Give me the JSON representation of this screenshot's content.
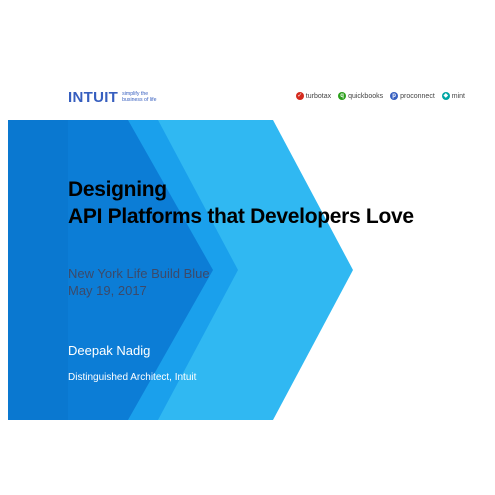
{
  "header": {
    "logo_text": "INTUIT",
    "tagline": "simplify the business of life",
    "brands": [
      {
        "label": "turbotax",
        "color": "#d52b1e",
        "icon": "turbotax-check-icon"
      },
      {
        "label": "quickbooks",
        "color": "#2ca01c",
        "icon": "quickbooks-qb-icon"
      },
      {
        "label": "proconnect",
        "color": "#365ebf",
        "icon": "proconnect-p-icon"
      },
      {
        "label": "mint",
        "color": "#00a6a4",
        "icon": "mint-leaf-icon"
      }
    ]
  },
  "slide": {
    "title_line1": "Designing",
    "title_line2": "API Platforms that Developers Love",
    "subtitle_line1": "New York Life Build Blue",
    "subtitle_line2": "May 19, 2017",
    "presenter_name": "Deepak Nadig",
    "presenter_role": "Distinguished Architect, Intuit"
  },
  "colors": {
    "band_dark": "#0c7dd6",
    "band_mid": "#1aa0ec",
    "band_light": "#30b8f2",
    "brand_blue": "#365ebf"
  }
}
